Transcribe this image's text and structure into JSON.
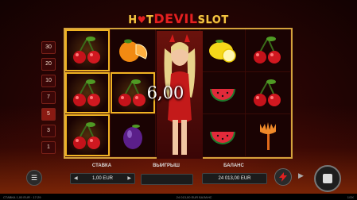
{
  "logo": {
    "part1": "H",
    "part2": "T",
    "part3": "DEVIL",
    "part4": "SLOT"
  },
  "lines": [
    "30",
    "20",
    "10",
    "7",
    "5",
    "3",
    "1"
  ],
  "active_line": "5",
  "reels": [
    [
      "cherry",
      "orange",
      "devil",
      "lemon",
      "cherry"
    ],
    [
      "cherry",
      "cherry",
      "devil",
      "watermelon",
      "cherry"
    ],
    [
      "cherry",
      "plum",
      "devil",
      "watermelon",
      "trident"
    ]
  ],
  "win_cells": [
    "0-0",
    "1-0",
    "2-0",
    "1-1"
  ],
  "win_amount": "6,00",
  "bottom_bar": {
    "bet_label": "СТАВКА",
    "bet_value": "1,00 EUR",
    "win_label": "ВЫИГРЫШ",
    "balance_label": "БАЛАНС",
    "balance_value": "24 013,00 EUR"
  },
  "status": {
    "left": "СТАВКА 1,00 EUR · 17:29",
    "center": "24 013,00 EUR БАЛАНС",
    "right": "1/3X"
  },
  "colors": {
    "frame": "#d4a23c",
    "accent_red": "#e32020",
    "gold": "#f4c542"
  }
}
